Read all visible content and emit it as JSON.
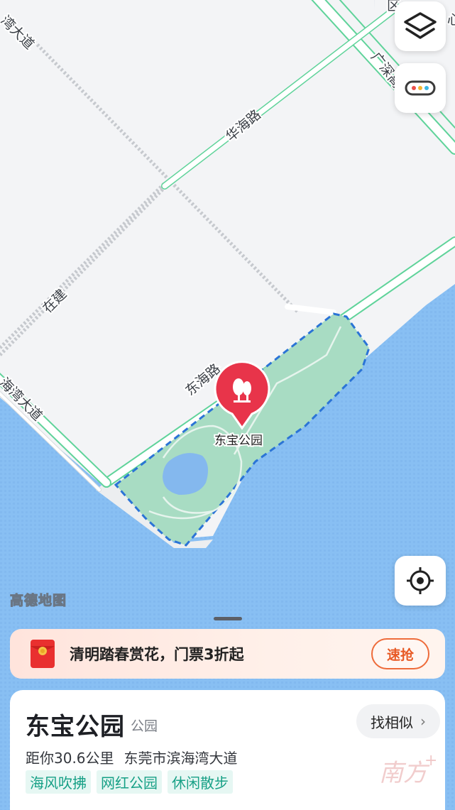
{
  "map": {
    "roads": {
      "binhai_top": "湾大道",
      "binhai_left": "海湾大道",
      "huahai": "华海路",
      "donghai": "东海路",
      "zaijian": "在建",
      "guangshen": "广深高速",
      "qu_label": "区",
      "xin_label": "心"
    },
    "poi_name": "东宝公园",
    "watermark": "高德地图",
    "colors": {
      "water": "#86bdf3",
      "park": "#a9dec4",
      "road_edge": "#5fd39a",
      "pin": "#e8344a"
    }
  },
  "controls": {
    "layers_icon": "layers-icon",
    "more_icon": "more-dots-icon",
    "locate_icon": "locate-crosshair-icon"
  },
  "promo": {
    "text": "清明踏春赏花，门票3折起",
    "button": "速抢",
    "icon": "red-envelope-icon"
  },
  "place": {
    "name": "东宝公园",
    "category": "公园",
    "similar_button": "找相似",
    "distance": "距你30.6公里",
    "address": "东莞市滨海湾大道",
    "tags": [
      "海风吹拂",
      "网红公园",
      "休闲散步"
    ]
  },
  "brand_watermark": "南方+"
}
